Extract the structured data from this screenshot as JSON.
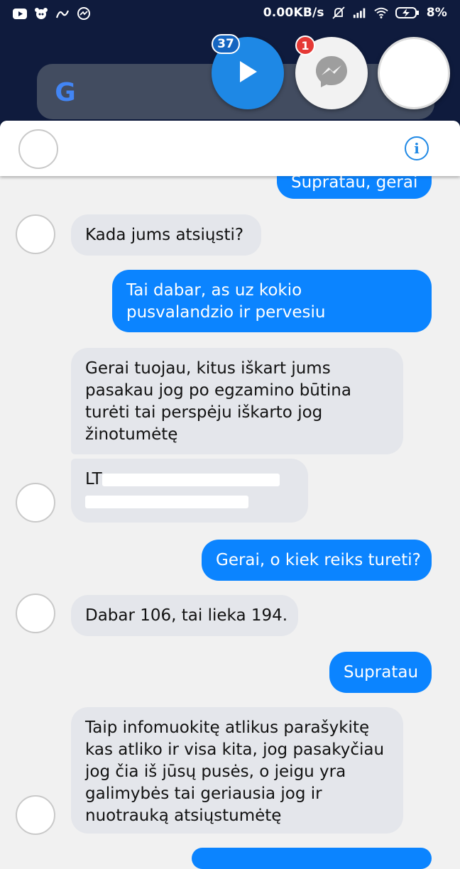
{
  "status_bar": {
    "network_speed": "0.00KB/s",
    "battery": "8%",
    "left_icons": [
      "youtube-icon",
      "notification-icon",
      "app-icon",
      "messenger-icon"
    ],
    "right_icons": [
      "mute-icon",
      "signal-icon",
      "wifi-icon",
      "battery-charging-icon"
    ]
  },
  "chat_heads": {
    "play_badge": "37",
    "messenger_badge": "1"
  },
  "header": {
    "info_label": "i"
  },
  "messages": [
    {
      "from": "me",
      "lines": [
        "Supratau, gerai"
      ]
    },
    {
      "from": "them",
      "lines": [
        "Kada jums atsiųsti?"
      ]
    },
    {
      "from": "me",
      "lines": [
        "Tai dabar, as uz kokio",
        "pusvalandzio ir pervesiu"
      ]
    },
    {
      "from": "them",
      "lines": [
        "Gerai tuojau, kitus iškart jums",
        "pasakau jog po egzamino būtina",
        "turėti tai perspėju iškarto jog",
        "žinotumėtę"
      ]
    },
    {
      "from": "them",
      "lines": [
        "LT"
      ]
    },
    {
      "from": "me",
      "lines": [
        "Gerai, o kiek reiks tureti?"
      ]
    },
    {
      "from": "them",
      "lines": [
        "Dabar 106, tai lieka 194."
      ]
    },
    {
      "from": "me",
      "lines": [
        "Supratau"
      ]
    },
    {
      "from": "them",
      "lines": [
        "Taip infomuokitę atlikus parašykitę",
        "kas atliko ir visa kita, jog pasakyčiau",
        "jog čia iš jūsų pusės, o jeigu yra",
        "galimybės tai geriausia jog ir",
        "nuotrauką atsiųstumėtę"
      ]
    }
  ],
  "colors": {
    "outgoing": "#0b84ff",
    "incoming": "#e4e6eb",
    "background": "#f1f1f1",
    "top_band": "#0f1b3d"
  }
}
